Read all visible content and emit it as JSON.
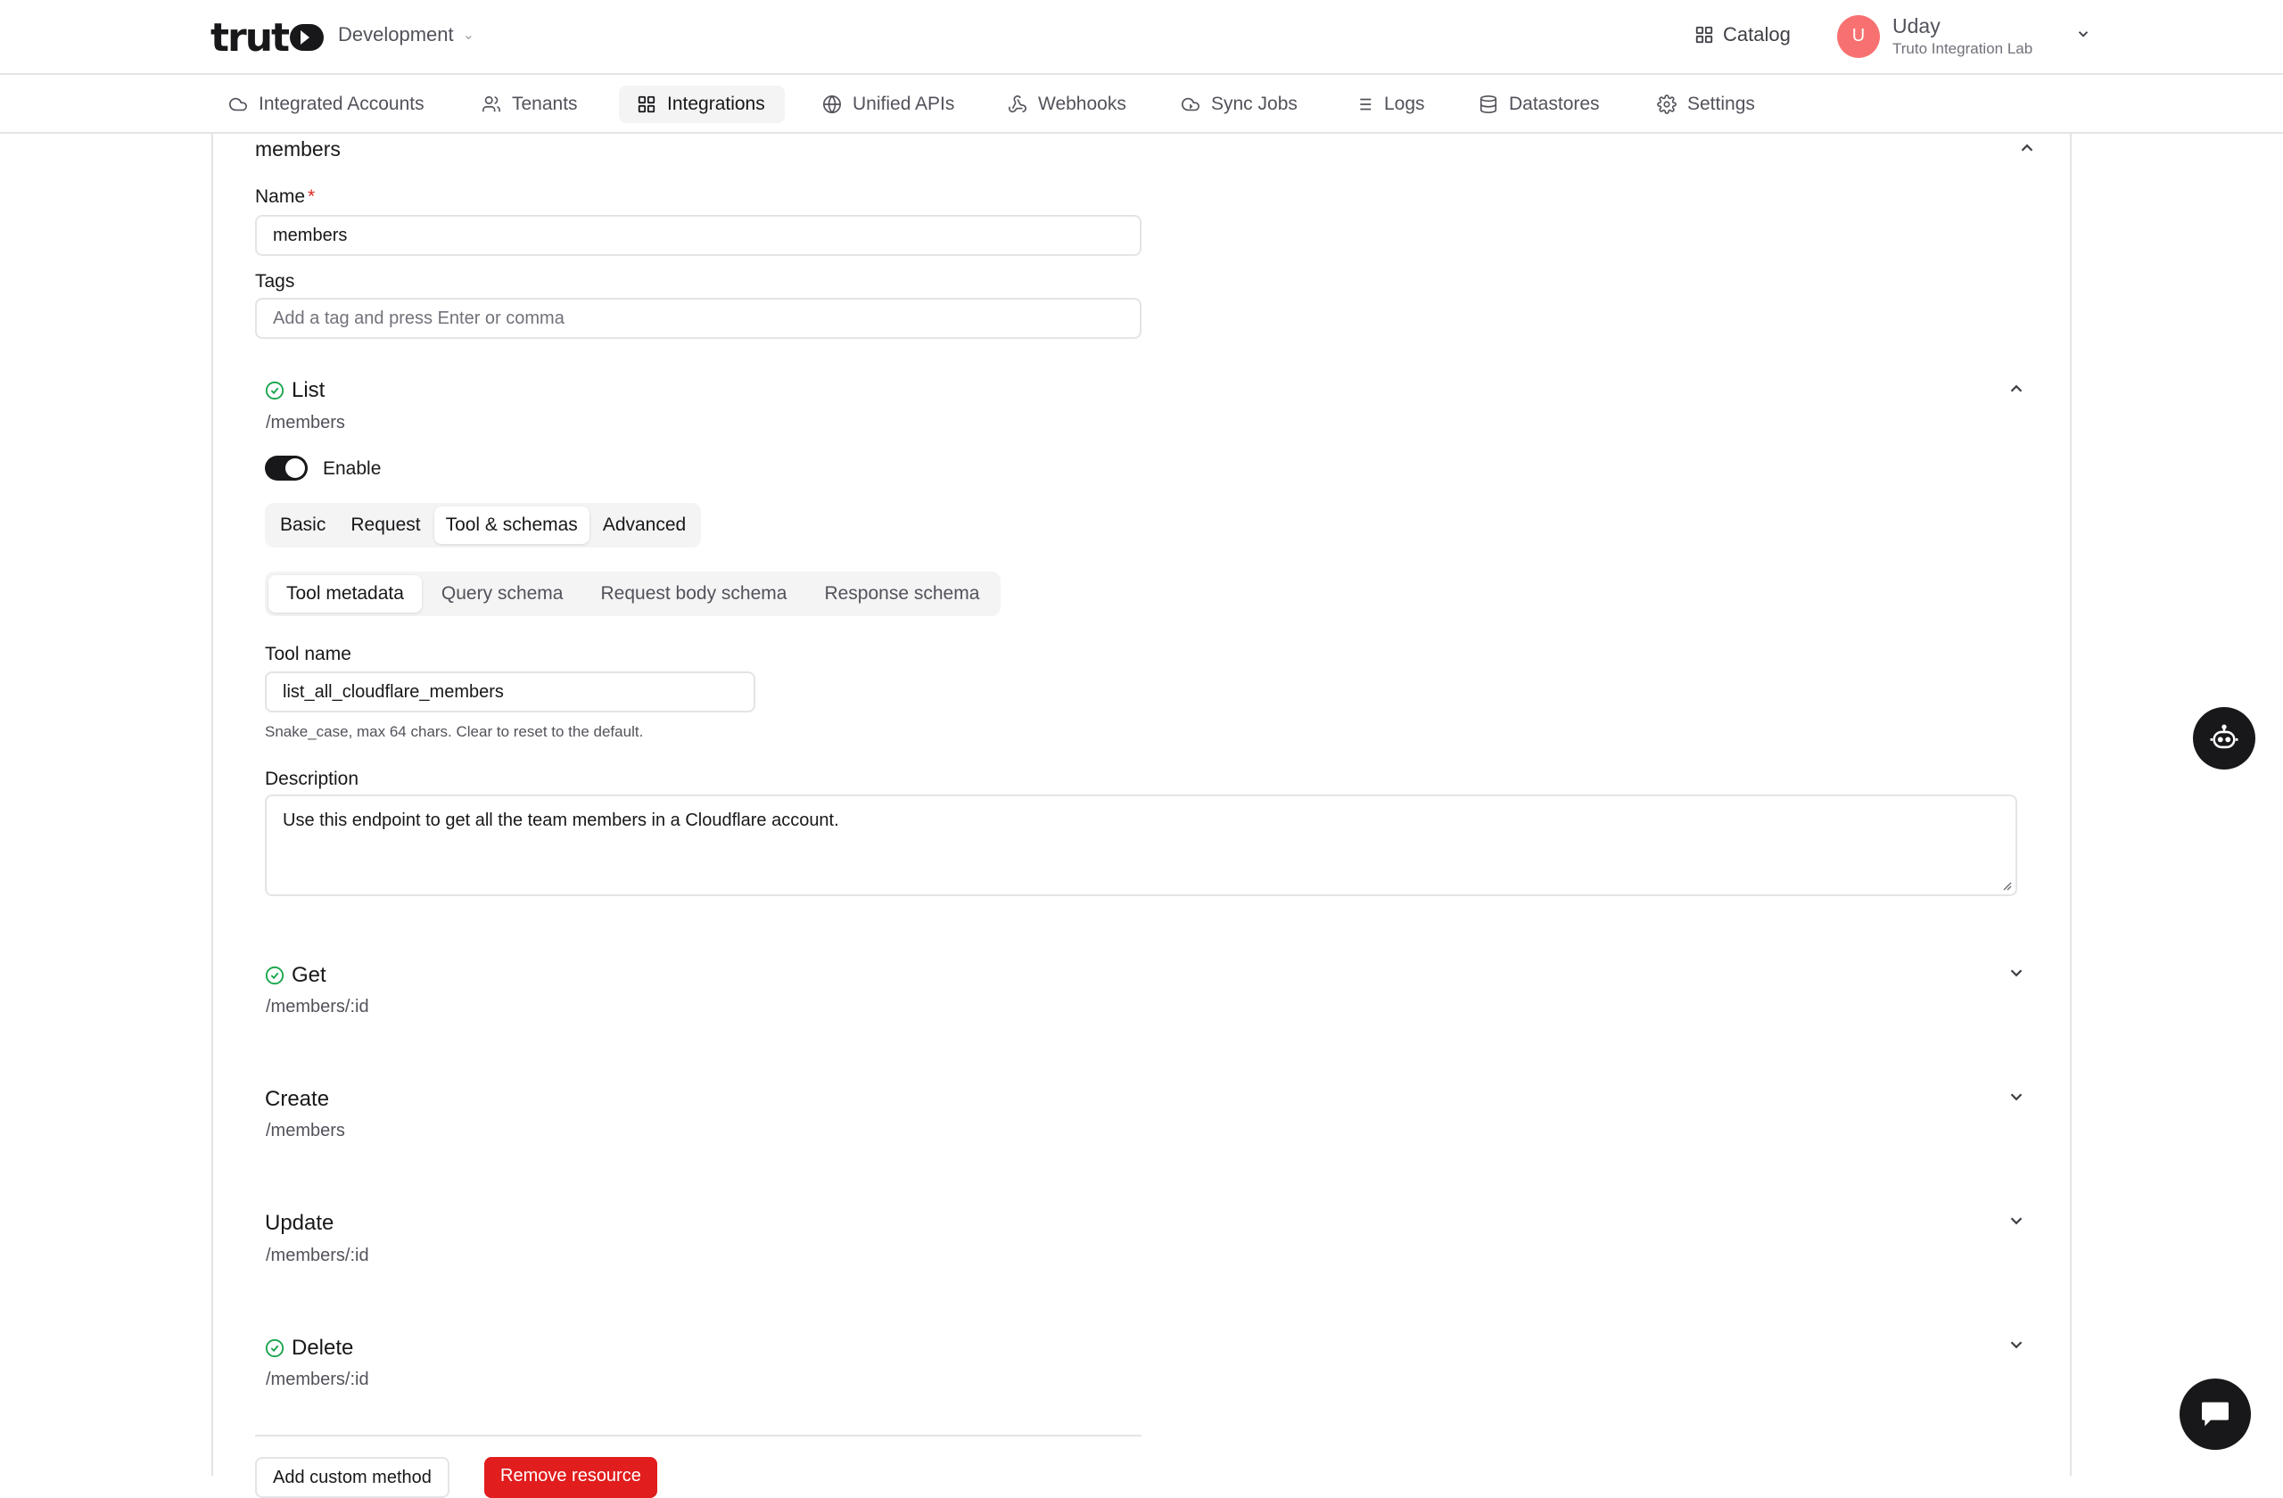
{
  "header": {
    "environment": "Development",
    "catalog_label": "Catalog",
    "user": {
      "initial": "U",
      "name": "Uday",
      "org": "Truto Integration Lab"
    }
  },
  "nav": {
    "items": [
      {
        "label": "Integrated Accounts",
        "icon": "cloud-icon"
      },
      {
        "label": "Tenants",
        "icon": "users-icon"
      },
      {
        "label": "Integrations",
        "icon": "grid-icon"
      },
      {
        "label": "Unified APIs",
        "icon": "globe-icon"
      },
      {
        "label": "Webhooks",
        "icon": "webhook-icon"
      },
      {
        "label": "Sync Jobs",
        "icon": "sync-icon"
      },
      {
        "label": "Logs",
        "icon": "list-icon"
      },
      {
        "label": "Datastores",
        "icon": "database-icon"
      },
      {
        "label": "Settings",
        "icon": "gear-icon"
      }
    ],
    "active": "Integrations"
  },
  "resource": {
    "title": "members",
    "name_label": "Name",
    "name_value": "members",
    "tags_label": "Tags",
    "tags_placeholder": "Add a tag and press Enter or comma"
  },
  "list_method": {
    "title": "List",
    "path": "/members",
    "enable_label": "Enable",
    "tabs": [
      "Basic",
      "Request",
      "Tool & schemas",
      "Advanced"
    ],
    "active_tab": "Tool & schemas",
    "subtabs": [
      "Tool metadata",
      "Query schema",
      "Request body schema",
      "Response schema"
    ],
    "active_subtab": "Tool metadata",
    "tool_name_label": "Tool name",
    "tool_name_value": "list_all_cloudflare_members",
    "tool_name_help": "Snake_case, max 64 chars. Clear to reset to the default.",
    "description_label": "Description",
    "description_value": "Use this endpoint to get all the team members in a Cloudflare account."
  },
  "methods": [
    {
      "title": "Get",
      "path": "/members/:id",
      "checked": true
    },
    {
      "title": "Create",
      "path": "/members",
      "checked": false
    },
    {
      "title": "Update",
      "path": "/members/:id",
      "checked": false
    },
    {
      "title": "Delete",
      "path": "/members/:id",
      "checked": true
    }
  ],
  "actions": {
    "add_custom_method": "Add custom method",
    "remove_resource": "Remove resource"
  },
  "colors": {
    "accent": "#18181b",
    "success": "#16a34a",
    "danger": "#e11d1d",
    "avatar": "#f87171"
  }
}
